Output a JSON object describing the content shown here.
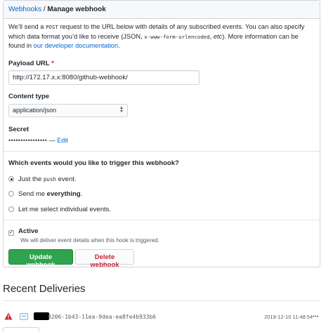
{
  "header": {
    "breadcrumb_parent": "Webhooks",
    "breadcrumb_sep": " / ",
    "breadcrumb_current": "Manage webhook"
  },
  "intro": {
    "text_a": "We’ll send a ",
    "code_post": "POST",
    "text_b": " request to the URL below with details of any subscribed events. You can also specify which data format you’d like to receive (JSON, ",
    "code_form": "x-www-form-urlencoded",
    "text_c": ", ",
    "text_etc": "etc",
    "text_d": "). More information can be found in ",
    "link": "our developer documentation",
    "text_e": "."
  },
  "payload_url": {
    "label": "Payload URL",
    "required_mark": "*",
    "value": "http://172.17.x.x:8080/github-webhook/"
  },
  "content_type": {
    "label": "Content type",
    "selected": "application/json"
  },
  "secret": {
    "label": "Secret",
    "masked": "••••••••••••••••",
    "separator": " — ",
    "edit_link": "Edit"
  },
  "events": {
    "question": "Which events would you like to trigger this webhook?",
    "options": [
      {
        "pre": "Just the ",
        "code": "push",
        "post": " event.",
        "checked": true
      },
      {
        "pre": "Send me ",
        "bold": "everything",
        "post": ".",
        "checked": false
      },
      {
        "pre": "Let me select individual events.",
        "checked": false
      }
    ]
  },
  "active": {
    "label": "Active",
    "checked": true,
    "note": "We will deliver event details when this hook is triggered."
  },
  "buttons": {
    "update": "Update webhook",
    "delete": "Delete webhook"
  },
  "deliveries": {
    "title": "Recent Deliveries",
    "items": [
      {
        "guid": "0206-1b43-11ea-9dea-ea8fe4b933b6",
        "timestamp": "2019-12-10 11:48:54",
        "status": "warning"
      }
    ]
  },
  "colors": {
    "link": "#0366d6",
    "primary": "#2ea44f",
    "danger": "#cb2431",
    "warning": "#cb2431"
  }
}
